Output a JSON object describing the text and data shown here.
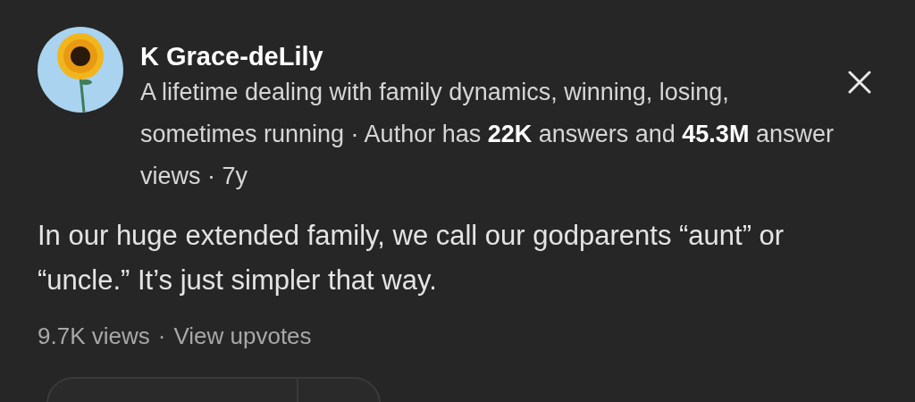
{
  "author": {
    "name": "K Grace-deLily",
    "bio": "A lifetime dealing with family dynamics, winning, losing, sometimes running · Author has **22K** answers and **45.3M** answer views · 7y"
  },
  "answer": {
    "text": "In our huge extended family, we call our godparents “aunt” or “uncle.” It’s just simpler that way."
  },
  "stats": {
    "views": "9.7K views",
    "separator": "·",
    "upvotes_link": "View upvotes"
  }
}
